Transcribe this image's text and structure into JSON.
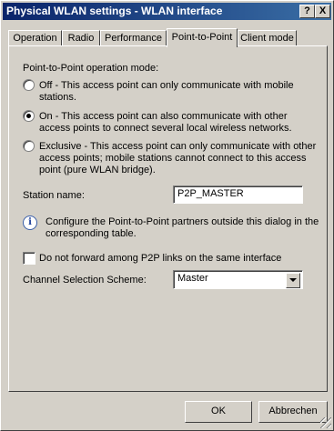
{
  "window": {
    "title": "Physical WLAN settings - WLAN interface",
    "help_label": "?",
    "close_label": "X"
  },
  "tabs": [
    {
      "label": "Operation"
    },
    {
      "label": "Radio"
    },
    {
      "label": "Performance"
    },
    {
      "label": "Point-to-Point",
      "active": true
    },
    {
      "label": "Client mode"
    }
  ],
  "p2p": {
    "mode_heading": "Point-to-Point operation mode:",
    "options": [
      {
        "line1": "Off - This access point can only communicate with mobile",
        "line2": "stations.",
        "selected": false
      },
      {
        "line1": "On - This access point can also communicate with other",
        "line2": "access points to connect several local wireless networks.",
        "selected": true
      },
      {
        "line1": "Exclusive - This access point can only communicate with other",
        "line2": "access points; mobile stations cannot connect to this access",
        "line3": "point (pure WLAN bridge).",
        "selected": false
      }
    ],
    "station_name_label": "Station name:",
    "station_name_value": "P2P_MASTER",
    "info_line1": "Configure the Point-to-Point partners outside this dialog in the",
    "info_line2": "corresponding table.",
    "no_forward_label": "Do not forward among P2P links on the same interface",
    "no_forward_checked": false,
    "channel_label": "Channel Selection Scheme:",
    "channel_value": "Master"
  },
  "buttons": {
    "ok": "OK",
    "cancel": "Abbrechen"
  }
}
